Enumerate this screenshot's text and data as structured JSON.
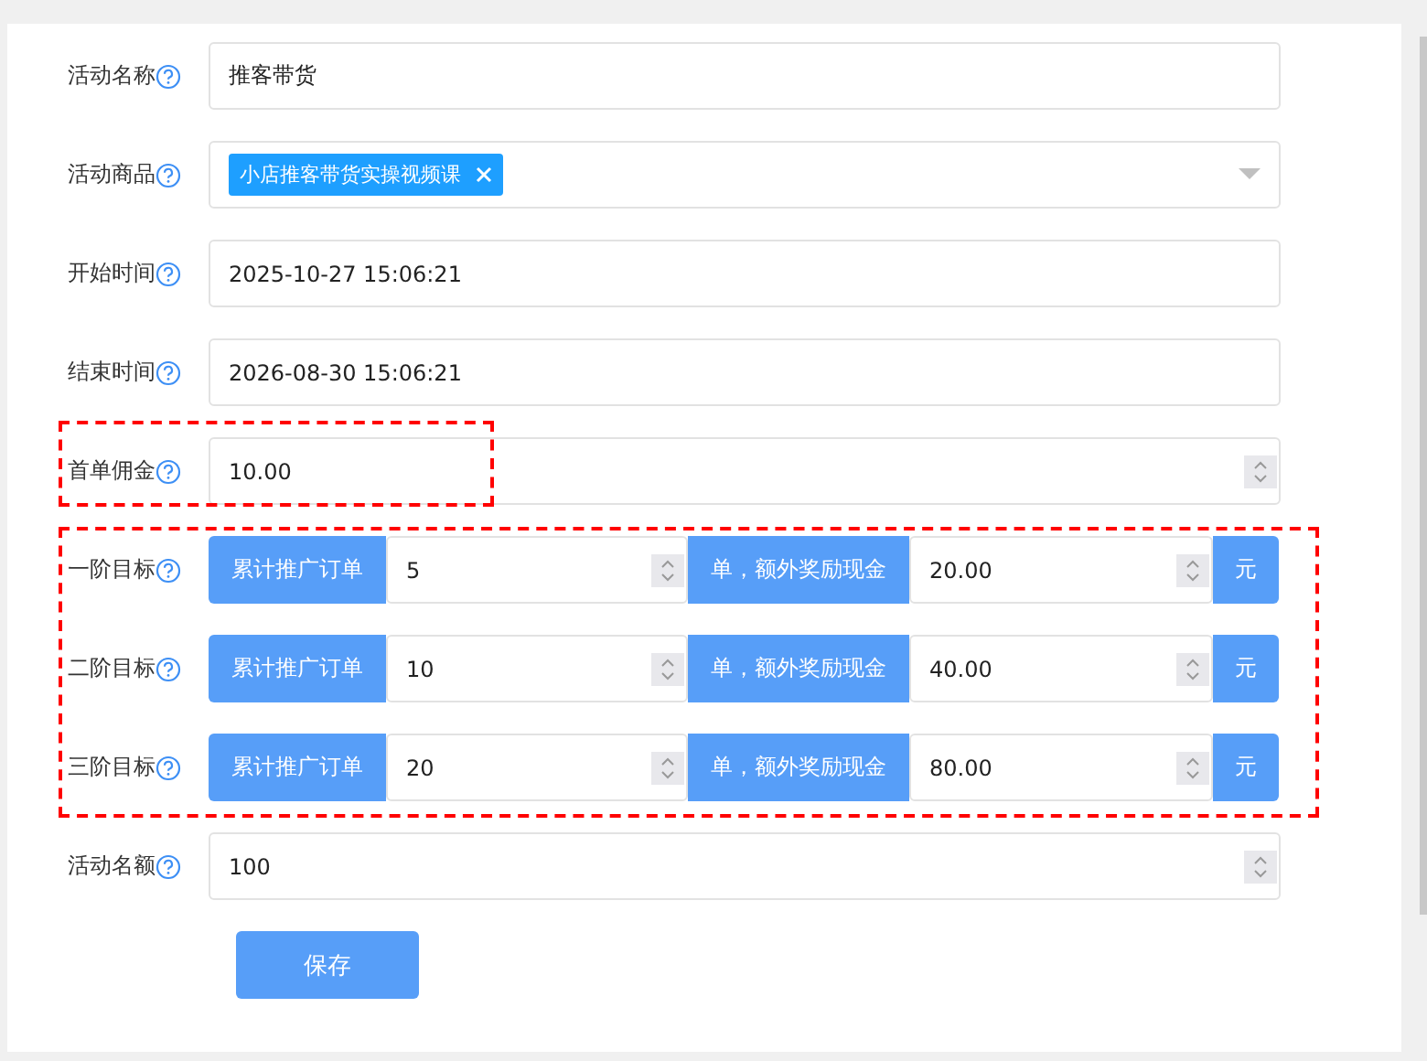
{
  "fields": [
    {
      "kind": "text",
      "label": "活动名称",
      "value": "推客带货",
      "highlighted": false
    },
    {
      "kind": "select",
      "label": "活动商品",
      "tags": [
        "小店推客带货实操视频课"
      ],
      "highlighted": false
    },
    {
      "kind": "text",
      "label": "开始时间",
      "value": "2025-10-27 15:06:21",
      "highlighted": false
    },
    {
      "kind": "text",
      "label": "结束时间",
      "value": "2026-08-30 15:06:21",
      "highlighted": false
    },
    {
      "kind": "number",
      "label": "首单佣金",
      "value": "10.00",
      "highlighted": true
    }
  ],
  "tiers": {
    "highlighted": true,
    "rows": [
      {
        "label": "一阶目标",
        "prefix": "累计推广订单",
        "count": "5",
        "middle": "单，额外奖励现金",
        "amount": "20.00",
        "suffix": "元"
      },
      {
        "label": "二阶目标",
        "prefix": "累计推广订单",
        "count": "10",
        "middle": "单，额外奖励现金",
        "amount": "40.00",
        "suffix": "元"
      },
      {
        "label": "三阶目标",
        "prefix": "累计推广订单",
        "count": "20",
        "middle": "单，额外奖励现金",
        "amount": "80.00",
        "suffix": "元"
      }
    ]
  },
  "quota": {
    "kind": "number",
    "label": "活动名额",
    "value": "100",
    "highlighted": false
  },
  "save_button": "保存"
}
